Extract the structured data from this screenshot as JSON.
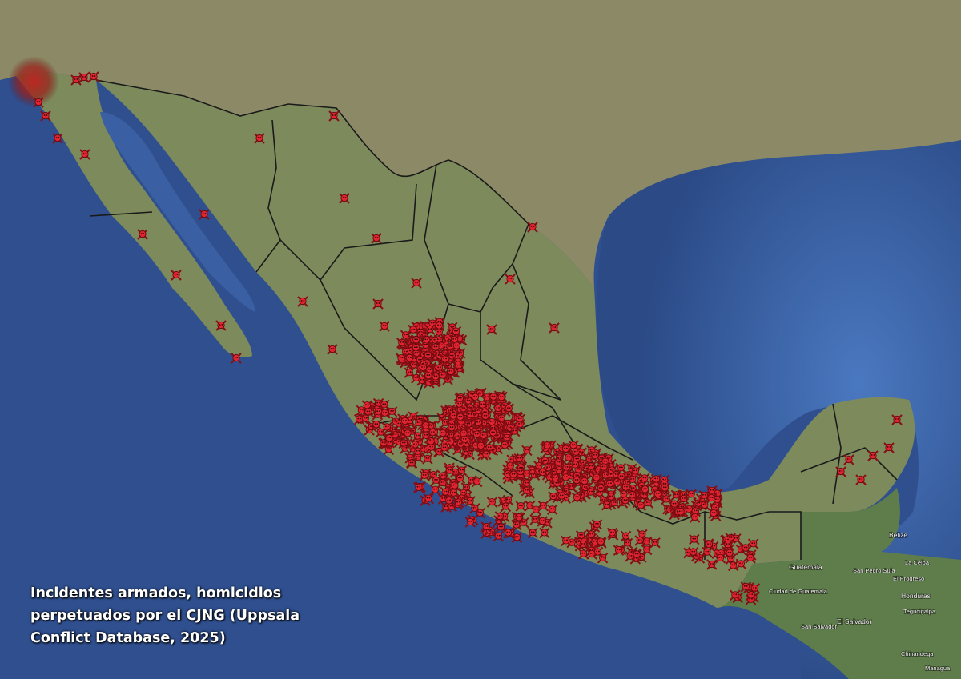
{
  "caption": {
    "lines": [
      "Incidentes armados, homicidios",
      "perpetuados por el CJNG (Uppsala",
      "Conflict Database,  2025)"
    ]
  },
  "map": {
    "colors": {
      "ocean": "#2f4f8f",
      "land_mexico": "#7d8a5c",
      "land_usa": "#8c8a66",
      "land_central_america": "#5f7d4a",
      "border": "#1a1a1a",
      "marker": "#d81e2a",
      "marker_glow": "#a01818"
    },
    "marker_icon": "skull-crossbones-icon",
    "places": [
      {
        "name": "Guatemala",
        "kind": "country"
      },
      {
        "name": "Ciudad de Guatemala",
        "kind": "city"
      },
      {
        "name": "San Salvador",
        "kind": "city"
      },
      {
        "name": "El Salvador",
        "kind": "country"
      },
      {
        "name": "Honduras",
        "kind": "country"
      },
      {
        "name": "Tegucigalpa",
        "kind": "city"
      },
      {
        "name": "San Pedro Sula",
        "kind": "city"
      },
      {
        "name": "La Ceiba",
        "kind": "city"
      },
      {
        "name": "El Progreso",
        "kind": "city"
      },
      {
        "name": "Chinandega",
        "kind": "city"
      },
      {
        "name": "Managua",
        "kind": "city"
      },
      {
        "name": "Belize",
        "kind": "country"
      }
    ]
  }
}
